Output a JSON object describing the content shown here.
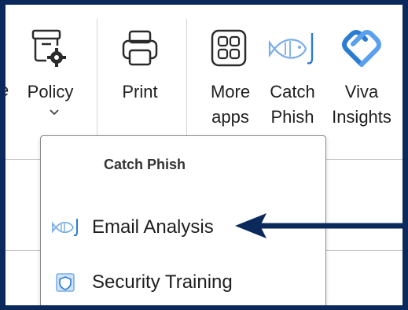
{
  "ribbon": {
    "commands": [
      {
        "id": "policy",
        "label": "Policy",
        "icon": "policy-gear-icon"
      },
      {
        "id": "print",
        "label": "Print",
        "icon": "printer-icon"
      },
      {
        "id": "more_apps",
        "label_line1": "More",
        "label_line2": "apps",
        "icon": "apps-grid-icon"
      },
      {
        "id": "catch_phish",
        "label_line1": "Catch",
        "label_line2": "Phish",
        "icon": "fish-icon"
      },
      {
        "id": "viva_insights",
        "label_line1": "Viva",
        "label_line2": "Insights",
        "icon": "viva-insights-icon"
      }
    ],
    "cut_off_left_text": "e"
  },
  "dropdown": {
    "title": "Catch Phish",
    "items": [
      {
        "label": "Email Analysis",
        "icon": "fish-icon"
      },
      {
        "label": "Security Training",
        "icon": "shield-icon"
      }
    ]
  },
  "annotation": {
    "icon": "pointer-arrow-icon",
    "color": "#0b2a5b"
  },
  "colors": {
    "frame": "#0b2a5b",
    "accent_blue": "#2b7cd3",
    "icon_light_blue": "#7aaee6"
  }
}
